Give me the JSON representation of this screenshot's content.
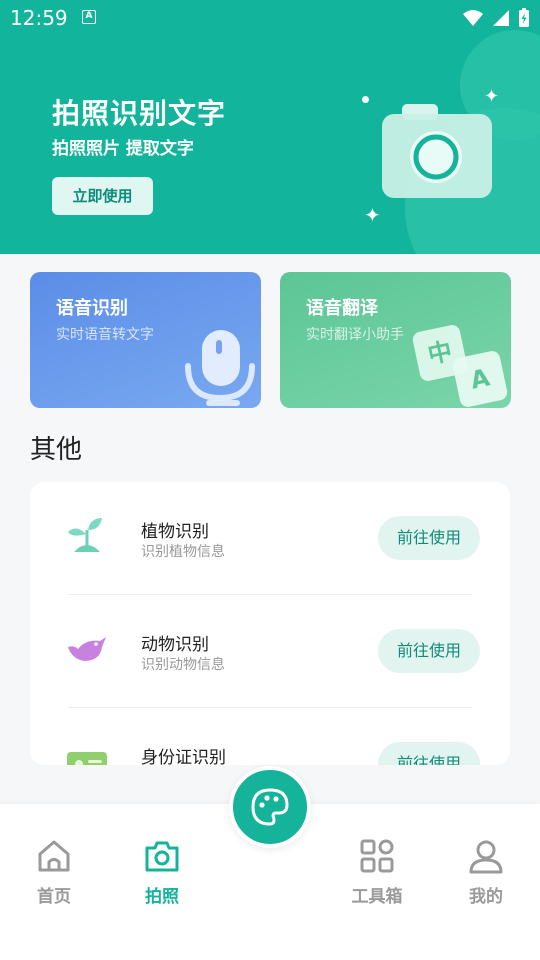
{
  "status_bar": {
    "time": "12:59",
    "notification_letter": "A"
  },
  "hero": {
    "title": "拍照识别文字",
    "subtitle": "拍照照片 提取文字",
    "button_label": "立即使用",
    "accent_color": "#12b59b"
  },
  "feature_cards": [
    {
      "title": "语音识别",
      "subtitle": "实时语音转文字",
      "icon": "microphone-icon"
    },
    {
      "title": "语音翻译",
      "subtitle": "实时翻译小助手",
      "icon": "translate-icon",
      "icon_chars": [
        "中",
        "A"
      ]
    }
  ],
  "other_section": {
    "title": "其他",
    "items": [
      {
        "title": "植物识别",
        "subtitle": "识别植物信息",
        "button": "前往使用",
        "icon": "plant-icon"
      },
      {
        "title": "动物识别",
        "subtitle": "识别动物信息",
        "button": "前往使用",
        "icon": "bird-icon"
      },
      {
        "title": "身份证识别",
        "subtitle": "",
        "button": "前往使用",
        "icon": "id-card-icon"
      }
    ]
  },
  "bottom_nav": {
    "items": [
      {
        "label": "首页",
        "icon": "home-icon",
        "active": false
      },
      {
        "label": "拍照",
        "icon": "camera-icon",
        "active": true
      },
      {
        "label": "工具箱",
        "icon": "grid-icon",
        "active": false
      },
      {
        "label": "我的",
        "icon": "user-icon",
        "active": false
      }
    ],
    "fab_icon": "palette-icon"
  }
}
